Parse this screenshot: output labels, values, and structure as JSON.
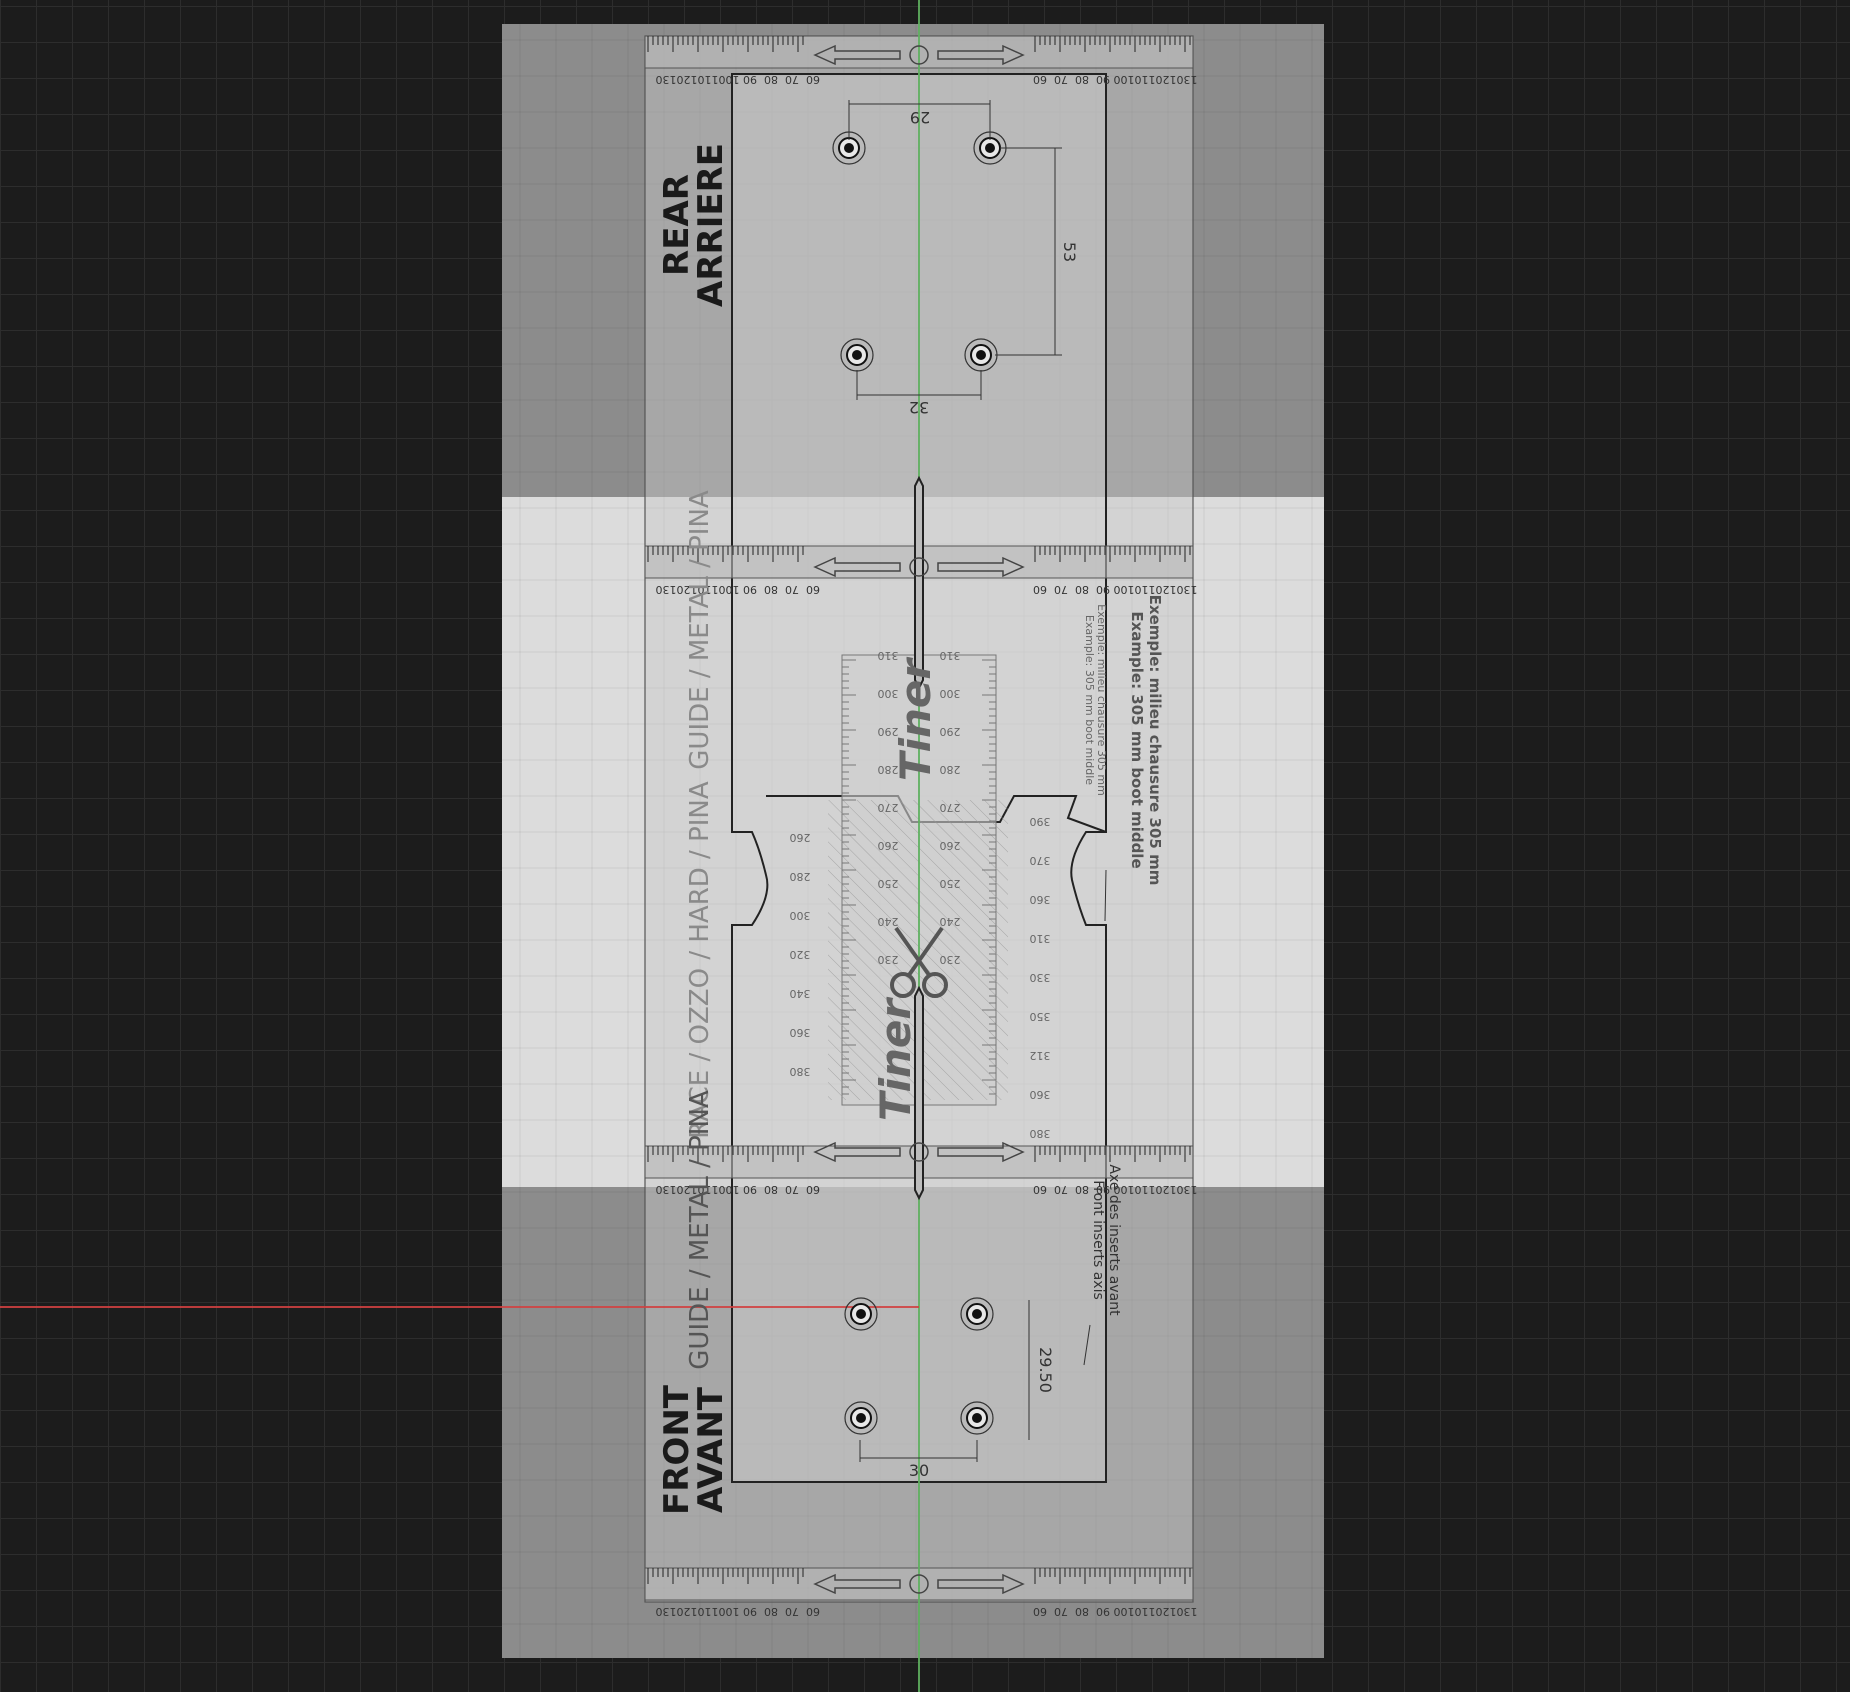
{
  "canvas": {
    "background": "#1c1c1c",
    "sheet_color": "#8c8c8c",
    "sheet_light_band_color": "#dcdcdc",
    "template_panel_color": "#b4b4b4",
    "vertical_axis_color": "#5fb060",
    "horizontal_axis_color": "#d04040"
  },
  "labels": {
    "rear": "REAR",
    "arriere": "ARRIERE",
    "front": "FRONT",
    "avant": "AVANT",
    "guide_top": "GUIDE / METAL / PINA",
    "guide_bottom": "GUIDE / METAL / PINA",
    "race": "RACE / OZZO / HARD / PINA",
    "example_fr": "Exemple: milieu chausure 305 mm",
    "example_en": "Example: 305 mm boot middle",
    "example_small_fr": "Exemple: milieu chausure 305 mm",
    "example_small_en": "Example: 305 mm boot middle",
    "axis_fr": "Axe des inserts avant",
    "axis_en": "Front inserts axis",
    "brand": "Tiner"
  },
  "dimensions": {
    "top_spacing": "29",
    "vertical_spacing": "53",
    "rear_spacing": "32",
    "front_vertical": "29.50",
    "front_spacing": "30"
  },
  "ruler_left": [
    "130",
    "120",
    "110",
    "100",
    "90",
    "80",
    "70",
    "60"
  ],
  "ruler_right": [
    "60",
    "70",
    "80",
    "90",
    "100",
    "110",
    "120",
    "130"
  ],
  "scale_center": [
    "310",
    "300",
    "290",
    "280",
    "270",
    "260",
    "250",
    "240",
    "230"
  ],
  "scale_left": [
    "260",
    "280",
    "300",
    "320",
    "340",
    "360",
    "380"
  ],
  "scale_right": [
    "390",
    "370",
    "360",
    "310",
    "330",
    "350",
    "312",
    "360",
    "380"
  ]
}
